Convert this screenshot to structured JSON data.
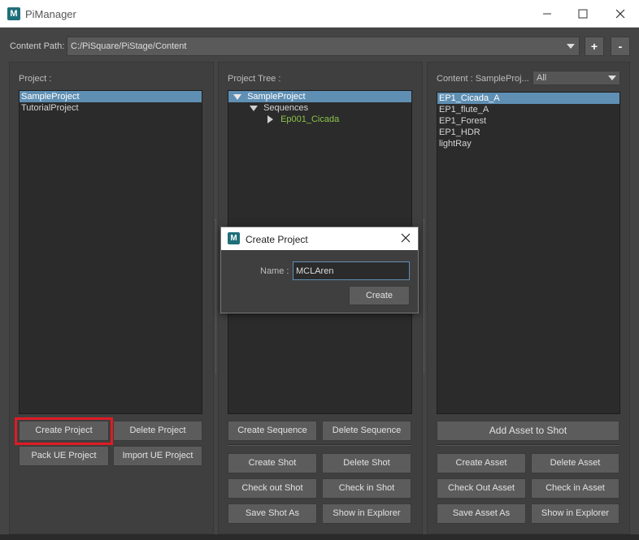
{
  "window": {
    "title": "PiManager",
    "logo_letter": "M",
    "icons": [
      "minimize-icon",
      "maximize-icon",
      "close-icon"
    ]
  },
  "content_path": {
    "label": "Content Path:",
    "value": "C:/PiSquare/PiStage/Content",
    "add_label": "+",
    "remove_label": "-"
  },
  "project_panel": {
    "label": "Project :",
    "items": [
      {
        "label": "SampleProject",
        "selected": true
      },
      {
        "label": "TutorialProject",
        "selected": false
      }
    ],
    "buttons": {
      "create": "Create Project",
      "delete": "Delete Project",
      "pack": "Pack UE Project",
      "import": "Import UE Project"
    }
  },
  "tree_panel": {
    "label": "Project Tree :",
    "root": "SampleProject",
    "child": "Sequences",
    "grandchild": "Ep001_Cicada",
    "buttons": {
      "create_sequence": "Create Sequence",
      "delete_sequence": "Delete Sequence",
      "create_shot": "Create Shot",
      "delete_shot": "Delete Shot",
      "check_out_shot": "Check out Shot",
      "check_in_shot": "Check in Shot",
      "save_shot_as": "Save Shot As",
      "show_in_explorer": "Show in Explorer"
    }
  },
  "content_panel": {
    "label": "Content : SampleProj...",
    "filter_value": "All",
    "items": [
      {
        "label": "EP1_Cicada_A",
        "selected": true
      },
      {
        "label": "EP1_flute_A",
        "selected": false
      },
      {
        "label": "EP1_Forest",
        "selected": false
      },
      {
        "label": "EP1_HDR",
        "selected": false
      },
      {
        "label": "lightRay",
        "selected": false
      }
    ],
    "buttons": {
      "add_asset_to_shot": "Add Asset to Shot",
      "create_asset": "Create Asset",
      "delete_asset": "Delete Asset",
      "check_out_asset": "Check Out Asset",
      "check_in_asset": "Check in Asset",
      "save_asset_as": "Save Asset As",
      "show_in_explorer": "Show in Explorer"
    }
  },
  "dialog": {
    "title": "Create Project",
    "logo_letter": "M",
    "name_label": "Name :",
    "name_value": "MCLAren",
    "create_label": "Create"
  },
  "colors": {
    "selection": "#5f8fb3",
    "tree_leaf": "#8bc34a",
    "highlight": "#e01b24"
  }
}
